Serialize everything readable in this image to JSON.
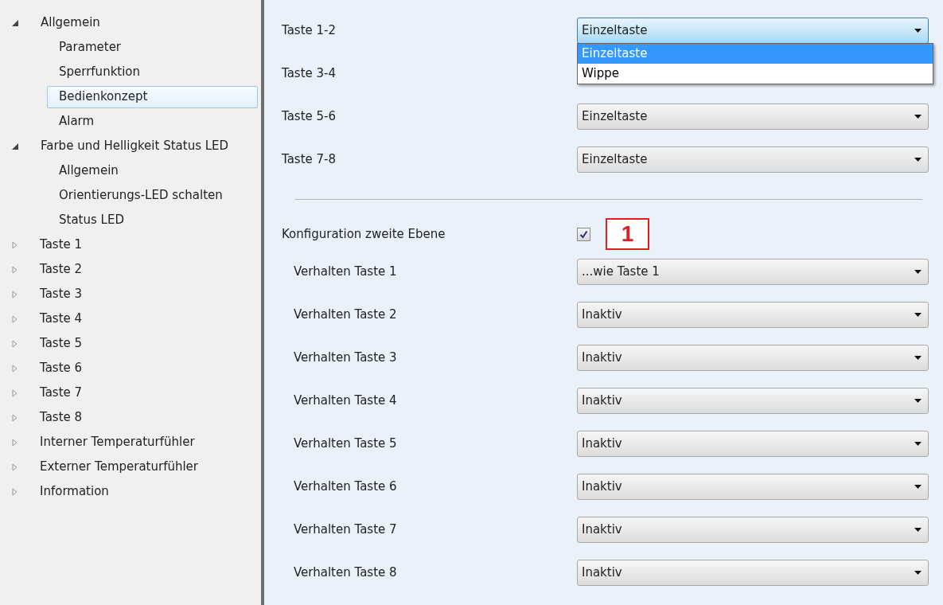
{
  "tree": [
    {
      "label": "Allgemein",
      "expanded": true,
      "selected": false,
      "children": [
        {
          "label": "Parameter",
          "selected": false
        },
        {
          "label": "Sperrfunktion",
          "selected": false
        },
        {
          "label": "Bedienkonzept",
          "selected": true
        },
        {
          "label": "Alarm",
          "selected": false
        }
      ]
    },
    {
      "label": "Farbe und Helligkeit Status LED",
      "expanded": true,
      "selected": false,
      "children": [
        {
          "label": "Allgemein",
          "selected": false
        },
        {
          "label": "Orientierungs-LED schalten",
          "selected": false
        },
        {
          "label": "Status LED",
          "selected": false
        }
      ]
    },
    {
      "label": "Taste 1",
      "expanded": false,
      "selected": false
    },
    {
      "label": "Taste 2",
      "expanded": false,
      "selected": false
    },
    {
      "label": "Taste 3",
      "expanded": false,
      "selected": false
    },
    {
      "label": "Taste 4",
      "expanded": false,
      "selected": false
    },
    {
      "label": "Taste 5",
      "expanded": false,
      "selected": false
    },
    {
      "label": "Taste 6",
      "expanded": false,
      "selected": false
    },
    {
      "label": "Taste 7",
      "expanded": false,
      "selected": false
    },
    {
      "label": "Taste 8",
      "expanded": false,
      "selected": false
    },
    {
      "label": "Interner Temperaturfühler",
      "expanded": false,
      "selected": false
    },
    {
      "label": "Externer Temperaturfühler",
      "expanded": false,
      "selected": false
    },
    {
      "label": "Information",
      "expanded": false,
      "selected": false
    }
  ],
  "parameters": [
    {
      "kind": "dropdown",
      "label": "Taste 1-2",
      "value": "Einzeltaste",
      "open": true,
      "options": [
        {
          "label": "Einzeltaste",
          "selected": true
        },
        {
          "label": "Wippe",
          "selected": false
        }
      ]
    },
    {
      "kind": "dropdown",
      "label": "Taste 3-4"
    },
    {
      "kind": "dropdown",
      "label": "Taste 5-6",
      "value": "Einzeltaste",
      "open": false
    },
    {
      "kind": "dropdown",
      "label": "Taste 7-8",
      "value": "Einzeltaste",
      "open": false
    },
    {
      "kind": "separator"
    },
    {
      "kind": "checkbox",
      "label": "Konfiguration zweite Ebene",
      "checked": true,
      "annotation": "1"
    },
    {
      "kind": "dropdown",
      "label": "Verhalten Taste 1",
      "value": "...wie Taste 1",
      "open": false,
      "indent": true
    },
    {
      "kind": "dropdown",
      "label": "Verhalten Taste 2",
      "value": "Inaktiv",
      "open": false,
      "indent": true
    },
    {
      "kind": "dropdown",
      "label": "Verhalten Taste 3",
      "value": "Inaktiv",
      "open": false,
      "indent": true
    },
    {
      "kind": "dropdown",
      "label": "Verhalten Taste 4",
      "value": "Inaktiv",
      "open": false,
      "indent": true
    },
    {
      "kind": "dropdown",
      "label": "Verhalten Taste 5",
      "value": "Inaktiv",
      "open": false,
      "indent": true
    },
    {
      "kind": "dropdown",
      "label": "Verhalten Taste 6",
      "value": "Inaktiv",
      "open": false,
      "indent": true
    },
    {
      "kind": "dropdown",
      "label": "Verhalten Taste 7",
      "value": "Inaktiv",
      "open": false,
      "indent": true
    },
    {
      "kind": "dropdown",
      "label": "Verhalten Taste 8",
      "value": "Inaktiv",
      "open": false,
      "indent": true
    }
  ]
}
